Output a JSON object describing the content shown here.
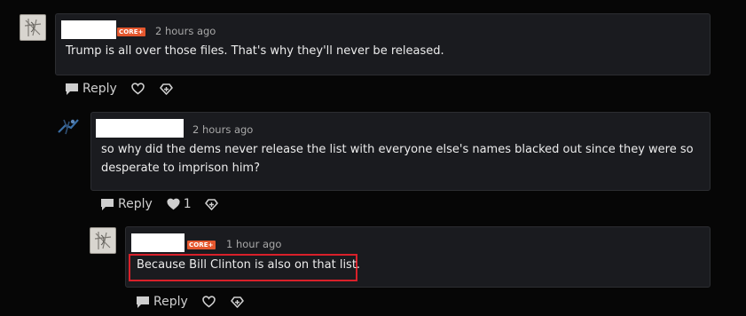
{
  "comments": [
    {
      "badge": "CORE+",
      "time": "2 hours ago",
      "body": "Trump is all over those files. That's why they'll never be released.",
      "reply_label": "Reply",
      "likes": ""
    },
    {
      "badge": "",
      "time": "2 hours ago",
      "body_line1": "so why did the dems never release the list with everyone else's names blacked out since they were so",
      "body_line2": "desperate to imprison him?",
      "reply_label": "Reply",
      "likes": "1"
    },
    {
      "badge": "CORE+",
      "time": "1 hour ago",
      "body": "Because Bill Clinton is also on that list.",
      "reply_label": "Reply",
      "likes": ""
    }
  ],
  "icons": {
    "reply": "speech-bubble-icon",
    "like": "heart-icon",
    "boost": "repost-icon"
  },
  "colors": {
    "badge": "#e4572e",
    "highlight": "#d9202a",
    "card": "#1a1b1f",
    "background": "#060606"
  }
}
